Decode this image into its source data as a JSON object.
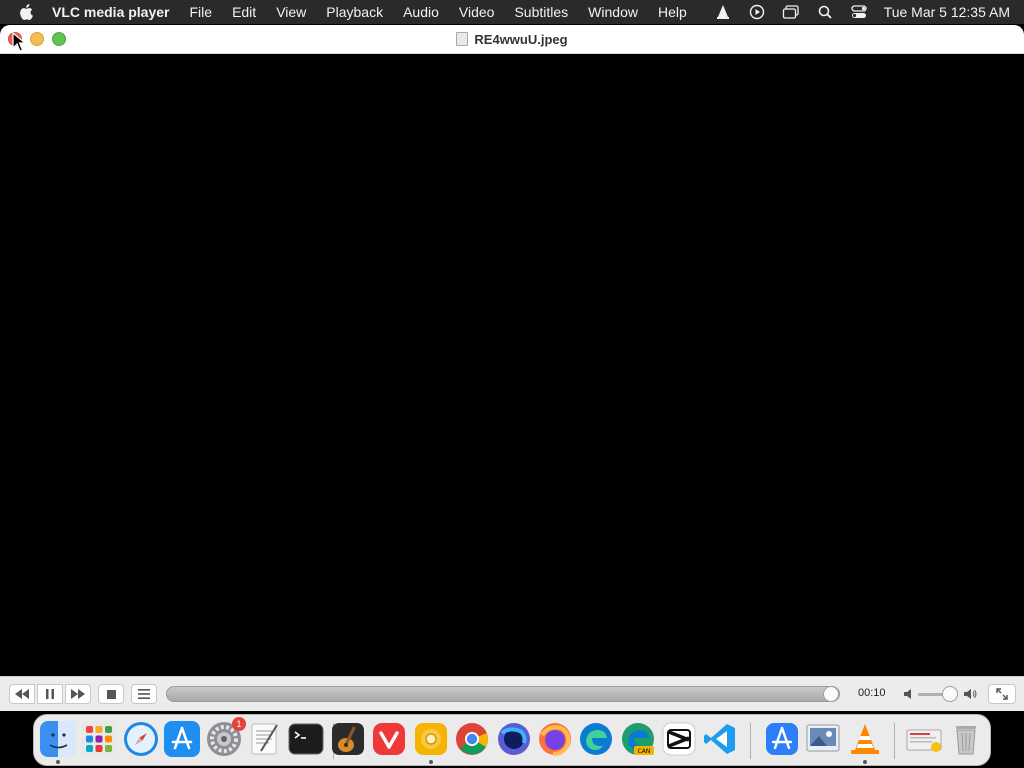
{
  "menubar": {
    "app_name": "VLC media player",
    "items": [
      "File",
      "Edit",
      "View",
      "Playback",
      "Audio",
      "Video",
      "Subtitles",
      "Window",
      "Help"
    ],
    "status_icons": [
      "vlc-cone-icon",
      "play-circle-icon",
      "window-stack-icon",
      "search-icon",
      "control-center-icon"
    ],
    "clock": "Tue Mar 5  12:35 AM"
  },
  "window": {
    "title": "RE4wwuU.jpeg"
  },
  "controls": {
    "time": "00:10",
    "playback_progress": 1.0,
    "volume_level": 0.75
  },
  "dock": {
    "apps": [
      {
        "name": "finder-icon",
        "color": "#3a8ff0"
      },
      {
        "name": "launchpad-icon",
        "color": "#e8e8e8"
      },
      {
        "name": "safari-icon",
        "color": "#1e88e5"
      },
      {
        "name": "app-store-icon",
        "color": "#1f8ef1"
      },
      {
        "name": "system-settings-icon",
        "color": "#8e8e93",
        "badge": "1"
      },
      {
        "name": "textedit-icon",
        "color": "#f5f5f5"
      },
      {
        "name": "terminal-icon",
        "color": "#1c1c1e"
      },
      {
        "name": "garageband-icon",
        "color": "#2b2b2b"
      },
      {
        "name": "vivaldi-icon",
        "color": "#ef3939"
      },
      {
        "name": "chrome-canary-icon",
        "color": "#f4b400"
      },
      {
        "name": "chrome-icon",
        "color": "#ffffff"
      },
      {
        "name": "firefox-nightly-icon",
        "color": "#5b5bd6"
      },
      {
        "name": "firefox-icon",
        "color": "#ff7139"
      },
      {
        "name": "edge-icon",
        "color": "#0c7bd4"
      },
      {
        "name": "edge-canary-icon",
        "color": "#1e9e6a",
        "label": "CAN"
      },
      {
        "name": "capcut-icon",
        "color": "#111111"
      },
      {
        "name": "vscode-icon",
        "color": "#1f9cf0"
      },
      {
        "name": "xcode-simulator-icon",
        "color": "#2d7ff9"
      },
      {
        "name": "preview-icon",
        "color": "#6b8bb7"
      },
      {
        "name": "vlc-icon",
        "color": "#ff8800"
      },
      {
        "name": "downloads-folder-icon",
        "color": "#f0f0f0"
      },
      {
        "name": "trash-icon",
        "color": "#c8c8c8"
      }
    ]
  }
}
